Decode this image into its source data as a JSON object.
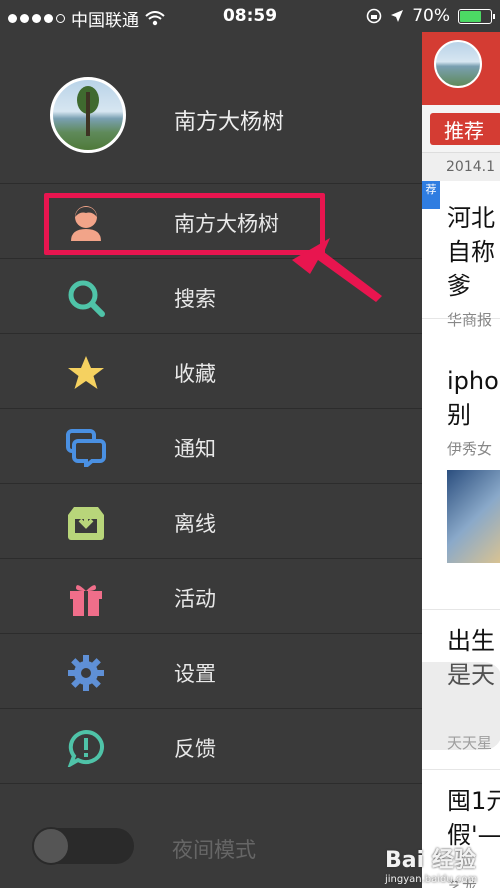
{
  "status": {
    "carrier": "中国联通",
    "time": "08:59",
    "battery": "70%",
    "battery_level": 0.7
  },
  "profile": {
    "name": "南方大杨树"
  },
  "menu": [
    {
      "label": "南方大杨树",
      "icon": "user-icon"
    },
    {
      "label": "搜索",
      "icon": "search-icon"
    },
    {
      "label": "收藏",
      "icon": "star-icon"
    },
    {
      "label": "通知",
      "icon": "notification-icon"
    },
    {
      "label": "离线",
      "icon": "offline-download-icon"
    },
    {
      "label": "活动",
      "icon": "gift-icon"
    },
    {
      "label": "设置",
      "icon": "gear-icon"
    },
    {
      "label": "反馈",
      "icon": "feedback-icon"
    }
  ],
  "night_mode": {
    "label": "夜间模式",
    "enabled": false
  },
  "content": {
    "tab": "推荐",
    "date": "2014.1",
    "badge": "荐",
    "articles": [
      {
        "title_lines": [
          "河北",
          "自称",
          "爹"
        ],
        "source": "华商报"
      },
      {
        "title_lines": [
          "ipho",
          "别"
        ],
        "source": "伊秀女"
      },
      {
        "title_lines": [
          "出生",
          "是天"
        ],
        "source": "天天星"
      },
      {
        "title_lines": [
          "囤1元",
          "假'—"
        ],
        "source": "艺龙"
      }
    ]
  },
  "watermark": {
    "text": "Bai 经验",
    "sub": "jingyan.baidu.com"
  }
}
